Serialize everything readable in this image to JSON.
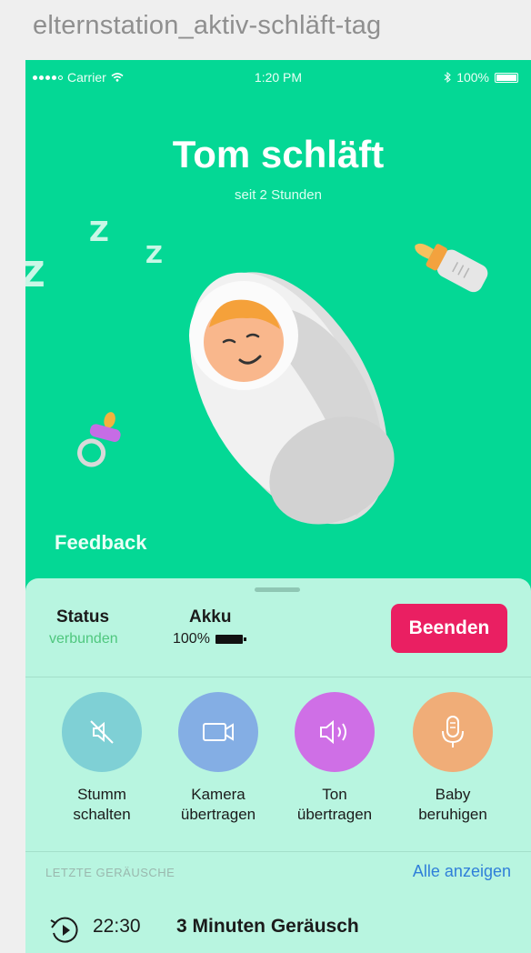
{
  "artboard_title": "elternstation_aktiv-schläft-tag",
  "status_bar": {
    "carrier": "Carrier",
    "time": "1:20 PM",
    "battery": "100%"
  },
  "hero": {
    "title": "Tom schläft",
    "subtitle": "seit 2 Stunden",
    "z_letters": [
      "Z",
      "Z",
      "Z"
    ]
  },
  "feedback_label": "Feedback",
  "status": {
    "label": "Status",
    "value": "verbunden",
    "battery_label": "Akku",
    "battery_value": "100%"
  },
  "end_button": "Beenden",
  "actions": [
    {
      "line1": "Stumm",
      "line2": "schalten",
      "icon": "mute-icon"
    },
    {
      "line1": "Kamera",
      "line2": "übertragen",
      "icon": "camera-icon"
    },
    {
      "line1": "Ton",
      "line2": "übertragen",
      "icon": "speaker-icon"
    },
    {
      "line1": "Baby",
      "line2": "beruhigen",
      "icon": "microphone-icon"
    }
  ],
  "recent": {
    "title": "LETZTE GERÄUSCHE",
    "show_all": "Alle anzeigen",
    "items": [
      {
        "time": "22:30",
        "description": "3 Minuten Geräusch"
      }
    ]
  },
  "colors": {
    "background": "#04d895",
    "sheet": "#b8f5e0",
    "end_button": "#ea1f62",
    "connected": "#4fc77e",
    "link": "#2f7fd9"
  }
}
